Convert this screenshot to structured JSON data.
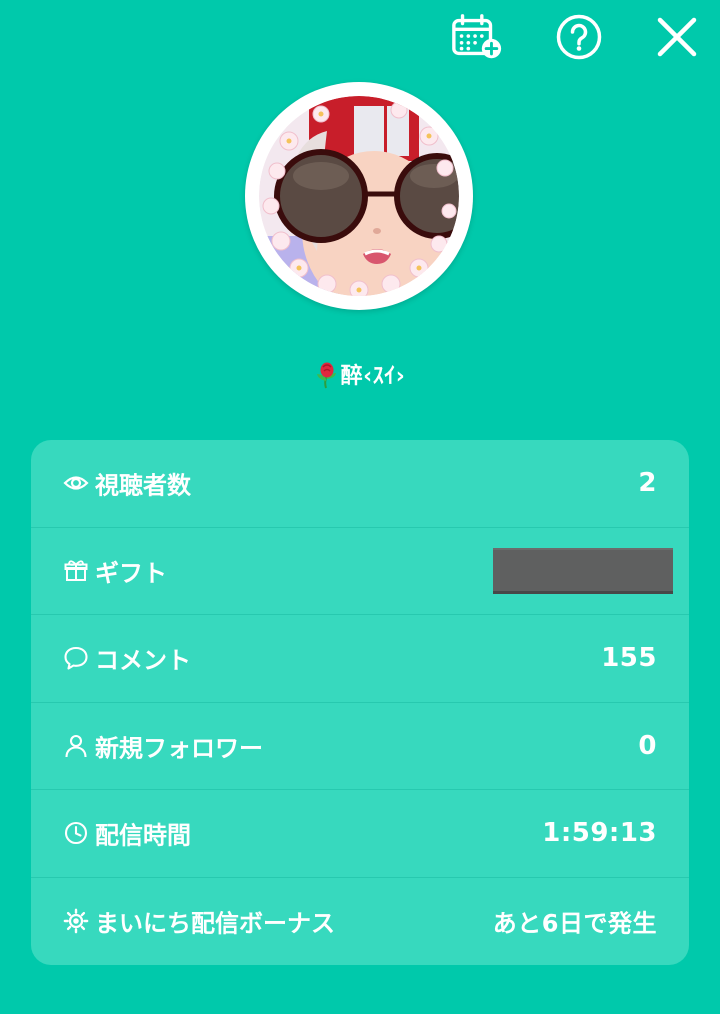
{
  "header": {
    "icons": [
      "calendar-add-icon",
      "help-icon",
      "close-icon"
    ]
  },
  "profile": {
    "username": "醉‹ｽｲ›"
  },
  "stats": [
    {
      "icon": "eye-icon",
      "label": "視聴者数",
      "value": "2"
    },
    {
      "icon": "gift-icon",
      "label": "ギフト",
      "value": ""
    },
    {
      "icon": "comment-icon",
      "label": "コメント",
      "value": "155"
    },
    {
      "icon": "person-icon",
      "label": "新規フォロワー",
      "value": "0"
    },
    {
      "icon": "clock-icon",
      "label": "配信時間",
      "value": "1:59:13"
    },
    {
      "icon": "sun-icon",
      "label": "まいにち配信ボーナス",
      "value": "あと6日で発生"
    }
  ],
  "colors": {
    "background": "#00c9ab",
    "card": "#37d9be",
    "text": "#ffffff",
    "redacted": "#5f6060"
  }
}
